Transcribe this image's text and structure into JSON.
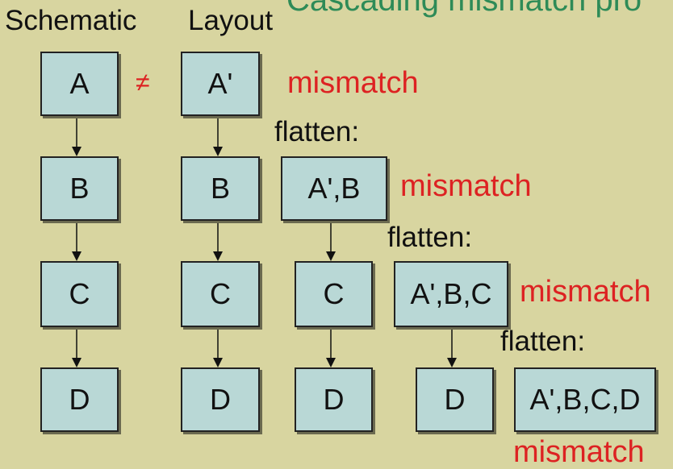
{
  "title": "Cascading mismatch pro",
  "headers": {
    "schematic": "Schematic",
    "layout": "Layout"
  },
  "not_equal": "≠",
  "schematic_boxes": [
    "A",
    "B",
    "C",
    "D"
  ],
  "layout_boxes": [
    "A'",
    "B",
    "C",
    "D"
  ],
  "stage1_boxes": [
    "A',B",
    "C",
    "D"
  ],
  "stage2_boxes": [
    "A',B,C",
    "D"
  ],
  "stage3_boxes": [
    "A',B,C,D"
  ],
  "flatten_label": "flatten:",
  "mismatch_label": "mismatch",
  "colors": {
    "background": "#d8d5a0",
    "box_fill": "#b9d8d6",
    "mismatch": "#dd2222",
    "title": "#2e8b57"
  }
}
